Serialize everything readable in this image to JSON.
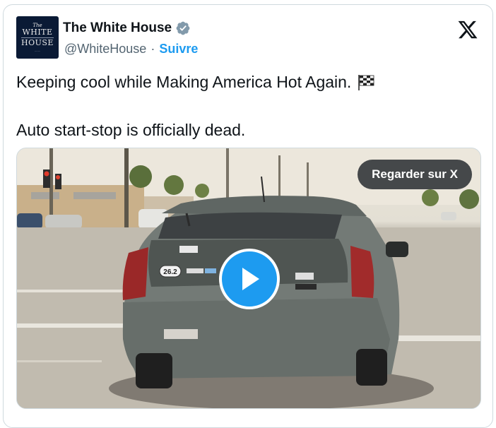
{
  "account": {
    "name": "The White House",
    "handle": "@WhiteHouse",
    "separator": "·",
    "follow_label": "Suivre",
    "verified_icon": "verified-badge-icon",
    "avatar": {
      "line_the": "The",
      "line_1": "WHITE",
      "line_2": "HOUSE"
    }
  },
  "tweet": {
    "text_line_1": "Keeping cool while Making America Hot Again.",
    "emoji": "checkered-flag-icon",
    "text_line_2": "Auto start-stop is officially dead."
  },
  "media": {
    "watch_label": "Regarder sur X",
    "play_icon": "play-icon",
    "plate_sticker": "26.2"
  },
  "colors": {
    "accent": "#1d9bf0",
    "text": "#0f1419",
    "secondary": "#536471",
    "avatar_bg": "#0a1a35"
  }
}
